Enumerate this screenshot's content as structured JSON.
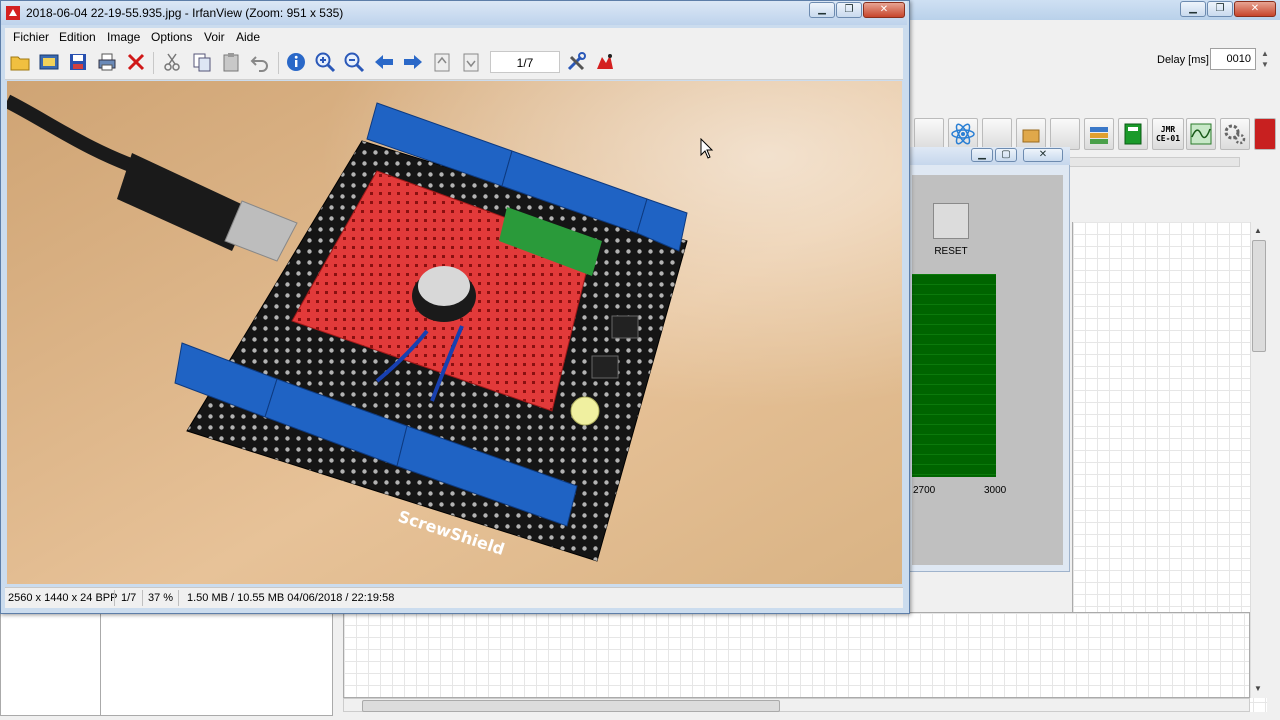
{
  "irfanview": {
    "title": "2018-06-04 22-19-55.935.jpg - IrfanView (Zoom: 951 x 535)",
    "menu": [
      "Fichier",
      "Edition",
      "Image",
      "Options",
      "Voir",
      "Aide"
    ],
    "page_indicator": "1/7",
    "status": {
      "dimensions": "2560 x 1440 x 24 BPP",
      "page": "1/7",
      "zoom": "37 %",
      "file_info": "1.50 MB / 10.55 MB 04/06/2018 / 22:19:58"
    },
    "photo": {
      "board_label": "ScrewShield"
    }
  },
  "background_app": {
    "delay_label": "Delay [ms]",
    "delay_value": "0010",
    "toolbar_jmr": "JMR\nCE-01",
    "child_window": {
      "reset_label": "RESET",
      "x_ticks": [
        "2700",
        "3000"
      ]
    }
  },
  "colors": {
    "chart_green": "#006400",
    "titlebar": "#bed3ec"
  }
}
